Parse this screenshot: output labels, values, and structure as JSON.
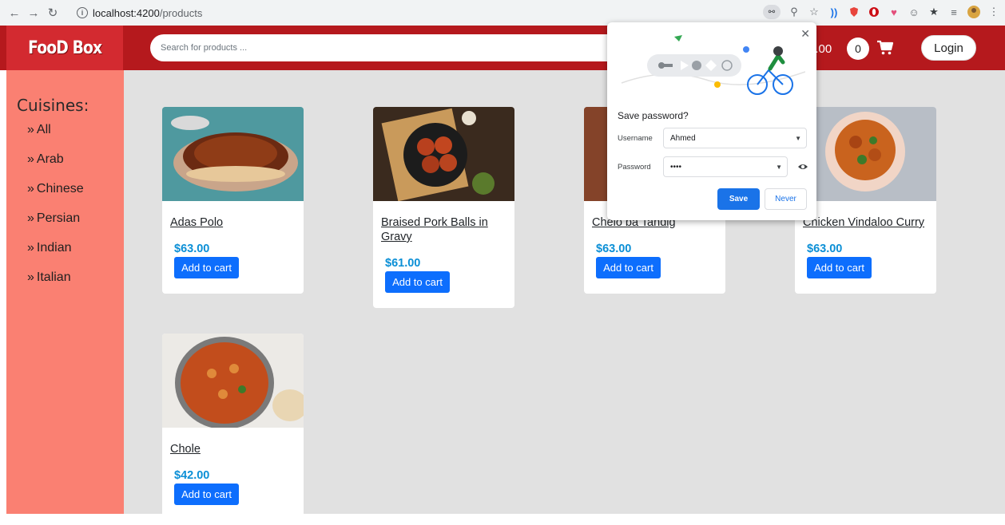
{
  "browser": {
    "url_host": "localhost:4200",
    "url_path": "/products",
    "icons": [
      "back-icon",
      "forward-icon",
      "reload-icon",
      "info-icon",
      "key-icon",
      "zoom-icon",
      "star-icon"
    ]
  },
  "header": {
    "brand": "FooD Box",
    "search_placeholder": "Search for products ...",
    "cart_total": "0.00",
    "cart_count": "0",
    "login_label": "Login",
    "colors": {
      "header_bg": "#b5191d",
      "brand_bg": "#d32a30"
    }
  },
  "sidebar": {
    "title": "Cuisines:",
    "items": [
      {
        "label": "All"
      },
      {
        "label": "Arab"
      },
      {
        "label": "Chinese"
      },
      {
        "label": "Persian"
      },
      {
        "label": "Indian"
      },
      {
        "label": "Italian"
      }
    ]
  },
  "products": [
    {
      "name": "Adas Polo",
      "price": "$63.00",
      "button": "Add to cart"
    },
    {
      "name": "Braised Pork Balls in Gravy",
      "price": "$61.00",
      "button": "Add to cart"
    },
    {
      "name": "Chelo ba Tahdig",
      "price": "$63.00",
      "button": "Add to cart"
    },
    {
      "name": "Chicken Vindaloo Curry",
      "price": "$63.00",
      "button": "Add to cart"
    },
    {
      "name": "Chole",
      "price": "$42.00",
      "button": "Add to cart"
    }
  ],
  "password_popup": {
    "title": "Save password?",
    "username_label": "Username",
    "username_value": "Ahmed",
    "password_label": "Password",
    "password_value": "••••",
    "save_label": "Save",
    "never_label": "Never"
  }
}
